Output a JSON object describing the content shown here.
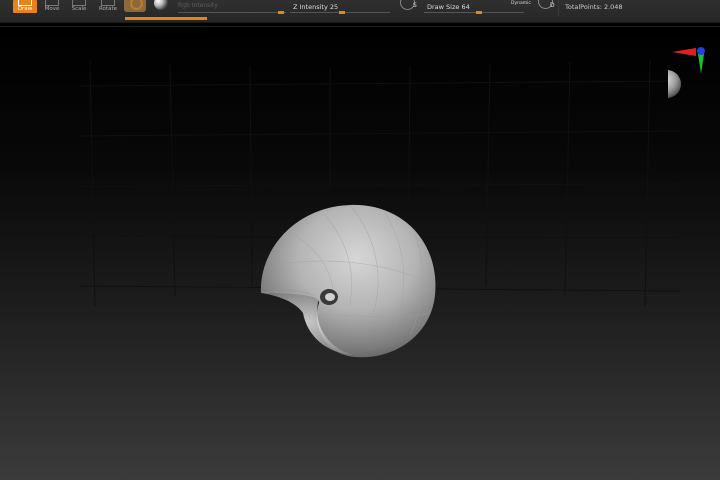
{
  "toolbar": {
    "tools": [
      {
        "label": "Draw",
        "active": true
      },
      {
        "label": "Move",
        "active": false
      },
      {
        "label": "Scale",
        "active": false
      },
      {
        "label": "Rotate",
        "active": false
      }
    ],
    "rgb_intensity_label": "Rgb Intensity",
    "z_intensity_label": "Z Intensity",
    "z_intensity_value": "25",
    "z_intensity_fraction": 0.25,
    "s_letter": "S",
    "draw_size_label": "Draw Size",
    "draw_size_value": "64",
    "draw_size_fraction": 0.56,
    "dynamic_label": "Dynamic",
    "d_letter": "D",
    "total_points": "TotalPoints: 2.048"
  },
  "colors": {
    "accent": "#e8821a",
    "toolbar_bg": "#2b2b2b",
    "axis_x": "#e02020",
    "axis_y": "#20c020",
    "axis_z": "#2040e0"
  },
  "icons": [
    "draw-icon",
    "move-icon",
    "scale-icon",
    "rotate-icon",
    "material-icon",
    "matcap-icon",
    "symmetry-icon",
    "dynamic-icon",
    "orientation-gizmo-icon"
  ]
}
